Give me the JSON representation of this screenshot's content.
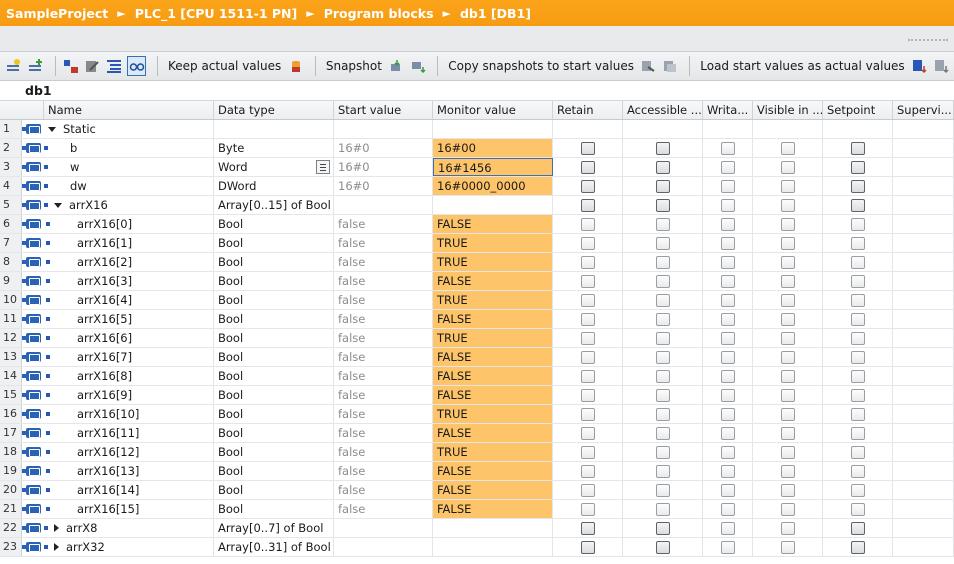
{
  "breadcrumb": [
    "SampleProject",
    "PLC_1 [CPU 1511-1 PN]",
    "Program blocks",
    "db1 [DB1]"
  ],
  "toolbar": {
    "keep_actual_values": "Keep actual values",
    "snapshot": "Snapshot",
    "copy_snapshots": "Copy snapshots to start values",
    "load_start_values": "Load start values as actual values"
  },
  "block_name": "db1",
  "columns": {
    "name": "Name",
    "data_type": "Data type",
    "start_value": "Start value",
    "monitor_value": "Monitor value",
    "retain": "Retain",
    "accessible": "Accessible ...",
    "writable": "Writa...",
    "visible": "Visible in ...",
    "setpoint": "Setpoint",
    "supervision": "Supervi..."
  },
  "rows": [
    {
      "num": "1",
      "name": "Static",
      "type": "",
      "start": "",
      "monitor": ""
    },
    {
      "num": "2",
      "name": "b",
      "type": "Byte",
      "start": "16#0",
      "monitor": "16#00"
    },
    {
      "num": "3",
      "name": "w",
      "type": "Word",
      "start": "16#0",
      "monitor": "16#1456"
    },
    {
      "num": "4",
      "name": "dw",
      "type": "DWord",
      "start": "16#0",
      "monitor": "16#0000_0000"
    },
    {
      "num": "5",
      "name": "arrX16",
      "type": "Array[0..15] of Bool",
      "start": "",
      "monitor": ""
    },
    {
      "num": "6",
      "name": "arrX16[0]",
      "type": "Bool",
      "start": "false",
      "monitor": "FALSE"
    },
    {
      "num": "7",
      "name": "arrX16[1]",
      "type": "Bool",
      "start": "false",
      "monitor": "TRUE"
    },
    {
      "num": "8",
      "name": "arrX16[2]",
      "type": "Bool",
      "start": "false",
      "monitor": "TRUE"
    },
    {
      "num": "9",
      "name": "arrX16[3]",
      "type": "Bool",
      "start": "false",
      "monitor": "FALSE"
    },
    {
      "num": "10",
      "name": "arrX16[4]",
      "type": "Bool",
      "start": "false",
      "monitor": "TRUE"
    },
    {
      "num": "11",
      "name": "arrX16[5]",
      "type": "Bool",
      "start": "false",
      "monitor": "FALSE"
    },
    {
      "num": "12",
      "name": "arrX16[6]",
      "type": "Bool",
      "start": "false",
      "monitor": "TRUE"
    },
    {
      "num": "13",
      "name": "arrX16[7]",
      "type": "Bool",
      "start": "false",
      "monitor": "FALSE"
    },
    {
      "num": "14",
      "name": "arrX16[8]",
      "type": "Bool",
      "start": "false",
      "monitor": "FALSE"
    },
    {
      "num": "15",
      "name": "arrX16[9]",
      "type": "Bool",
      "start": "false",
      "monitor": "FALSE"
    },
    {
      "num": "16",
      "name": "arrX16[10]",
      "type": "Bool",
      "start": "false",
      "monitor": "TRUE"
    },
    {
      "num": "17",
      "name": "arrX16[11]",
      "type": "Bool",
      "start": "false",
      "monitor": "FALSE"
    },
    {
      "num": "18",
      "name": "arrX16[12]",
      "type": "Bool",
      "start": "false",
      "monitor": "TRUE"
    },
    {
      "num": "19",
      "name": "arrX16[13]",
      "type": "Bool",
      "start": "false",
      "monitor": "FALSE"
    },
    {
      "num": "20",
      "name": "arrX16[14]",
      "type": "Bool",
      "start": "false",
      "monitor": "FALSE"
    },
    {
      "num": "21",
      "name": "arrX16[15]",
      "type": "Bool",
      "start": "false",
      "monitor": "FALSE"
    },
    {
      "num": "22",
      "name": "arrX8",
      "type": "Array[0..7] of Bool",
      "start": "",
      "monitor": ""
    },
    {
      "num": "23",
      "name": "arrX32",
      "type": "Array[0..31] of Bool",
      "start": "",
      "monitor": ""
    }
  ],
  "colors": {
    "accent": "#f79b12",
    "monitor_bg": "#fec469",
    "tag_blue": "#2a63b5"
  }
}
